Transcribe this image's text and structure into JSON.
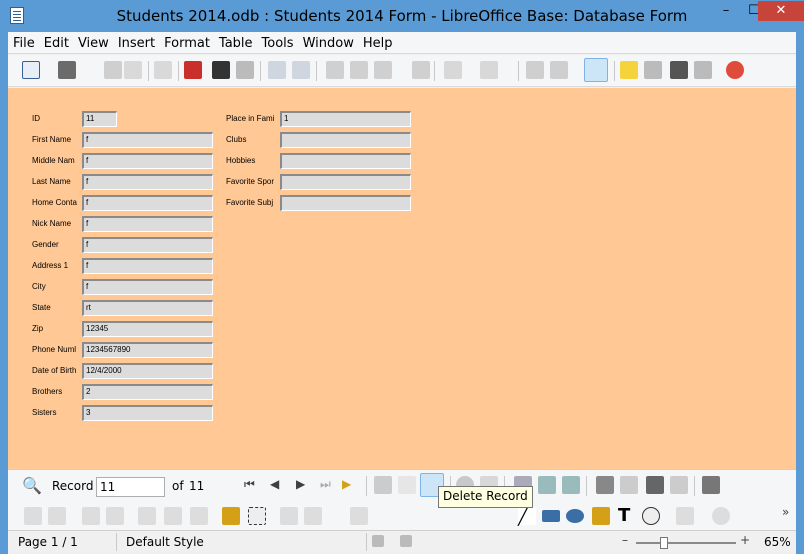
{
  "window": {
    "title": "Students 2014.odb : Students 2014 Form - LibreOffice Base: Database Form",
    "minimize": "–",
    "maximize": "☐",
    "close": "✕"
  },
  "menu": [
    "File",
    "Edit",
    "View",
    "Insert",
    "Format",
    "Table",
    "Tools",
    "Window",
    "Help"
  ],
  "form": {
    "left_fields": [
      {
        "label": "ID",
        "value": "11"
      },
      {
        "label": "First Name",
        "value": "f"
      },
      {
        "label": "Middle Nam",
        "value": "f"
      },
      {
        "label": "Last Name",
        "value": "f"
      },
      {
        "label": "Home Conta",
        "value": "f"
      },
      {
        "label": "Nick Name",
        "value": "f"
      },
      {
        "label": "Gender",
        "value": "f"
      },
      {
        "label": "Address 1",
        "value": "f"
      },
      {
        "label": "City",
        "value": "f"
      },
      {
        "label": "State",
        "value": "rt"
      },
      {
        "label": "Zip",
        "value": "12345"
      },
      {
        "label": "Phone Numl",
        "value": "1234567890"
      },
      {
        "label": "Date of Birth",
        "value": "12/4/2000"
      },
      {
        "label": "Brothers",
        "value": "2"
      },
      {
        "label": "Sisters",
        "value": "3"
      }
    ],
    "right_fields": [
      {
        "label": "Place in Famil",
        "value": "1"
      },
      {
        "label": "Clubs",
        "value": ""
      },
      {
        "label": "Hobbies",
        "value": ""
      },
      {
        "label": "Favorite Spor",
        "value": ""
      },
      {
        "label": "Favorite Subj",
        "value": ""
      }
    ]
  },
  "nav": {
    "record_label": "Record",
    "record_value": "11",
    "of_label": "of",
    "total": "11"
  },
  "tooltip": "Delete Record",
  "status": {
    "page": "Page 1 / 1",
    "style": "Default Style",
    "zoom": "65%"
  },
  "colors": {
    "form_bg": "#ffc894",
    "title_bar": "#5b9bd5"
  }
}
